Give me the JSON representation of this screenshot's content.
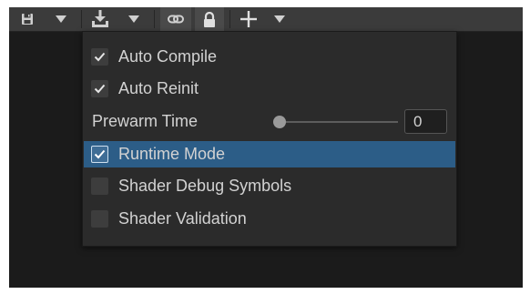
{
  "toolbar": {
    "icons": [
      "save-icon",
      "dropdown-arrow-icon",
      "download-icon",
      "dropdown-arrow-icon",
      "link-icon",
      "lock-icon",
      "plus-icon",
      "dropdown-arrow-icon"
    ]
  },
  "menu": {
    "items": [
      {
        "label": "Auto Compile",
        "checked": true
      },
      {
        "label": "Auto Reinit",
        "checked": true
      },
      {
        "label": "Runtime Mode",
        "checked": true,
        "highlighted": true
      },
      {
        "label": "Shader Debug Symbols",
        "checked": false
      },
      {
        "label": "Shader Validation",
        "checked": false
      }
    ],
    "prewarm": {
      "label": "Prewarm Time",
      "value": "0",
      "slider_level": 0
    }
  },
  "colors": {
    "toolbar_bg": "#3b3b3b",
    "menu_bg": "#2b2b2b",
    "selection": "#2c5d87",
    "text": "#d2d2d2"
  }
}
